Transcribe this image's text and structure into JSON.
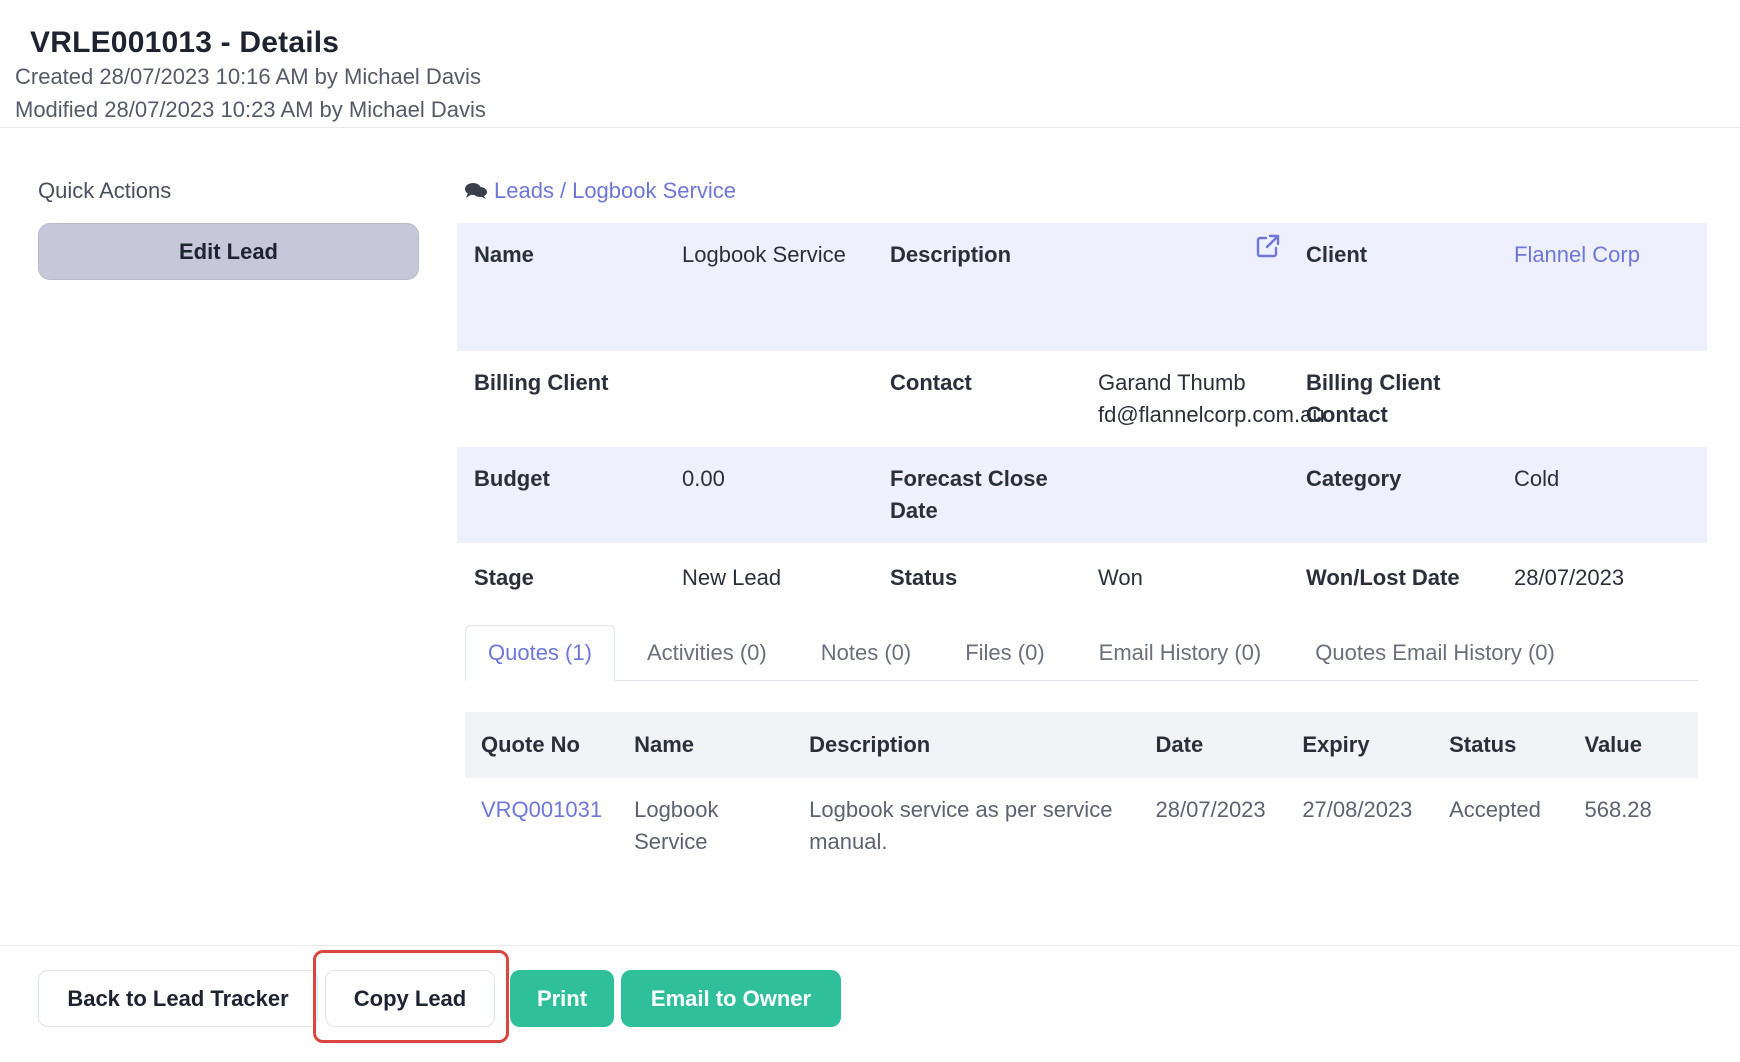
{
  "header": {
    "title": "VRLE001013 - Details",
    "created": "Created 28/07/2023 10:16 AM by Michael Davis",
    "modified": "Modified 28/07/2023 10:23 AM by Michael Davis"
  },
  "quick_actions": {
    "label": "Quick Actions",
    "edit_lead": "Edit Lead"
  },
  "breadcrumb": {
    "icon": "chat-bubbles-icon",
    "leads": "Leads",
    "separator": "/",
    "current": "Logbook Service"
  },
  "details": {
    "name_label": "Name",
    "name_value": "Logbook Service",
    "description_label": "Description",
    "external_link_icon": "external-link-icon",
    "client_label": "Client",
    "client_value": "Flannel Corp",
    "billing_client_label": "Billing Client",
    "contact_label": "Contact",
    "contact_value": "Garand Thumb fd@flannelcorp.com.au",
    "billing_client_contact_label": "Billing Client Contact",
    "budget_label": "Budget",
    "budget_value": "0.00",
    "forecast_close_label": "Forecast Close Date",
    "category_label": "Category",
    "category_value": "Cold",
    "stage_label": "Stage",
    "stage_value": "New Lead",
    "status_label": "Status",
    "status_value": "Won",
    "won_lost_label": "Won/Lost Date",
    "won_lost_value": "28/07/2023"
  },
  "tabs": [
    {
      "label": "Quotes (1)",
      "active": true
    },
    {
      "label": "Activities (0)",
      "active": false
    },
    {
      "label": "Notes (0)",
      "active": false
    },
    {
      "label": "Files (0)",
      "active": false
    },
    {
      "label": "Email History (0)",
      "active": false
    },
    {
      "label": "Quotes Email History (0)",
      "active": false
    }
  ],
  "quotes_table": {
    "headers": [
      "Quote No",
      "Name",
      "Description",
      "Date",
      "Expiry",
      "Status",
      "Value"
    ],
    "rows": [
      [
        "VRQ001031",
        "Logbook Service",
        "Logbook service as per service manual.",
        "28/07/2023",
        "27/08/2023",
        "Accepted",
        "568.28"
      ]
    ]
  },
  "footer": {
    "back": "Back to Lead Tracker",
    "copy": "Copy Lead",
    "print": "Print",
    "email_owner": "Email to Owner"
  },
  "colors": {
    "accent_link": "#6e76d8",
    "green_button": "#2fbf9b",
    "highlight": "#d9463e",
    "shaded_row": "#eef1fd"
  }
}
